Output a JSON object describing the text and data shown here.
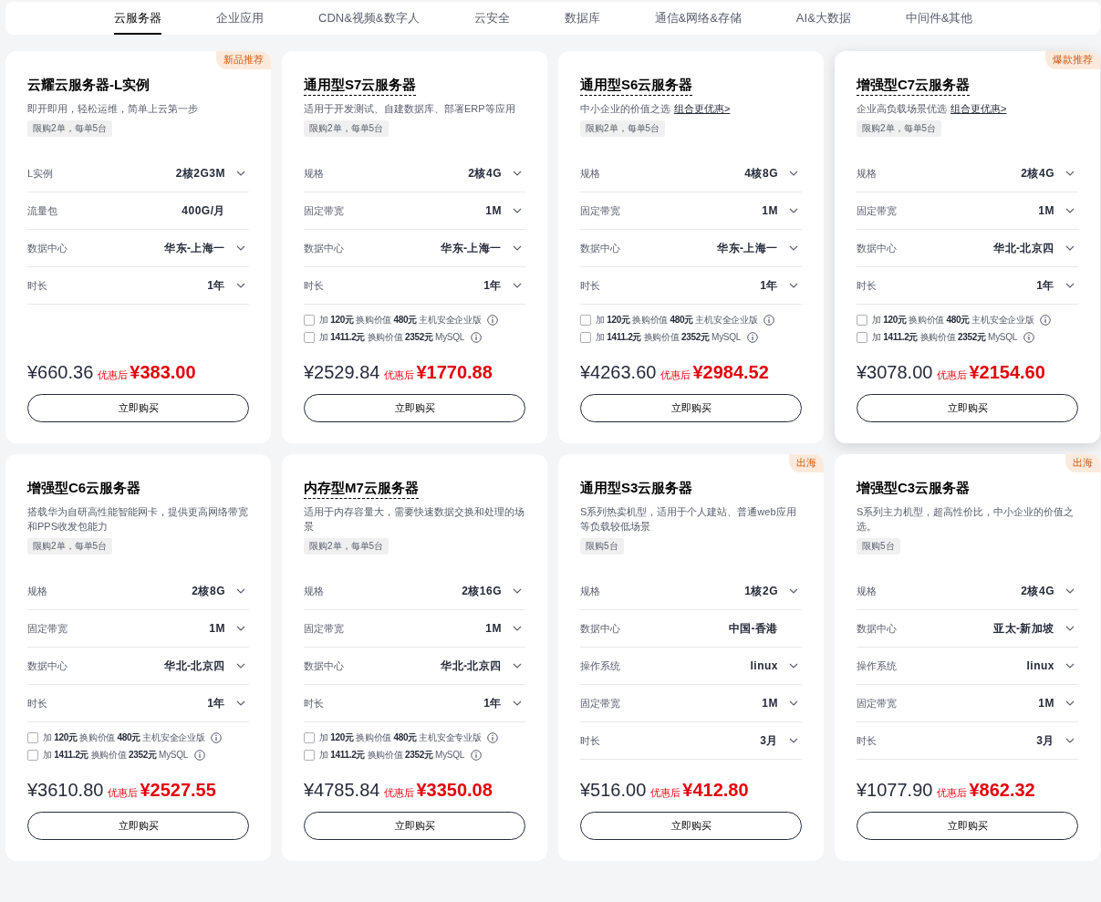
{
  "tabs": [
    {
      "label": "云服务器",
      "selected": true
    },
    {
      "label": "企业应用",
      "selected": false
    },
    {
      "label": "CDN&视频&数字人",
      "selected": false
    },
    {
      "label": "云安全",
      "selected": false
    },
    {
      "label": "数据库",
      "selected": false
    },
    {
      "label": "通信&网络&存储",
      "selected": false
    },
    {
      "label": "AI&大数据",
      "selected": false
    },
    {
      "label": "中间件&其他",
      "selected": false
    }
  ],
  "cards": [
    {
      "badge": "新品推荐",
      "title": "云耀云服务器-L实例",
      "underlined": false,
      "hovered": false,
      "description": "即开即用，轻松运维，简单上云第一步",
      "limit": "限购2单，每单5台",
      "specs": [
        {
          "label": "L实例",
          "value": "2核2G3M",
          "dropdown": true
        },
        {
          "label": "流量包",
          "value": "400G/月",
          "dropdown": false
        },
        {
          "label": "数据中心",
          "value": "华东-上海一",
          "dropdown": true
        },
        {
          "label": "时长",
          "value": "1年",
          "dropdown": true
        }
      ],
      "original_price": "¥660.36",
      "discount_label": "优惠后",
      "price": "¥383.00",
      "button": "立即购买"
    },
    {
      "title": "通用型S7云服务器",
      "underlined": true,
      "hovered": false,
      "description": "适用于开发测试、自建数据库、部署ERP等应用",
      "limit": "限购2单，每单5台",
      "specs": [
        {
          "label": "规格",
          "value": "2核4G",
          "dropdown": true
        },
        {
          "label": "固定带宽",
          "value": "1M",
          "dropdown": true
        },
        {
          "label": "数据中心",
          "value": "华东-上海一",
          "dropdown": true
        },
        {
          "label": "时长",
          "value": "1年",
          "dropdown": true
        }
      ],
      "addons": [
        {
          "text": "加 **120元** 换购价值 **480元** 主机安全企业版",
          "checked": false
        },
        {
          "text": "加 **1411.2元** 换购价值 **2352元** MySQL",
          "checked": false
        }
      ],
      "original_price": "¥2529.84",
      "discount_label": "优惠后",
      "price": "¥1770.88",
      "button": "立即购买"
    },
    {
      "title": "通用型S6云服务器",
      "underlined": true,
      "hovered": false,
      "description": "中小企业的价值之选",
      "link": "组合更优惠>",
      "limit": "限购2单，每单5台",
      "specs": [
        {
          "label": "规格",
          "value": "4核8G",
          "dropdown": true
        },
        {
          "label": "固定带宽",
          "value": "1M",
          "dropdown": true
        },
        {
          "label": "数据中心",
          "value": "华东-上海一",
          "dropdown": true
        },
        {
          "label": "时长",
          "value": "1年",
          "dropdown": true
        }
      ],
      "addons": [
        {
          "text": "加 **120元** 换购价值 **480元** 主机安全企业版",
          "checked": false
        },
        {
          "text": "加 **1411.2元** 换购价值 **2352元** MySQL",
          "checked": false
        }
      ],
      "original_price": "¥4263.60",
      "discount_label": "优惠后",
      "price": "¥2984.52",
      "button": "立即购买"
    },
    {
      "badge": "爆款推荐",
      "title": "增强型C7云服务器",
      "underlined": true,
      "hovered": true,
      "description": "企业高负载场景优选",
      "link": "组合更优惠>",
      "limit": "限购2单，每单5台",
      "specs": [
        {
          "label": "规格",
          "value": "2核4G",
          "dropdown": true
        },
        {
          "label": "固定带宽",
          "value": "1M",
          "dropdown": true
        },
        {
          "label": "数据中心",
          "value": "华北-北京四",
          "dropdown": true
        },
        {
          "label": "时长",
          "value": "1年",
          "dropdown": true
        }
      ],
      "addons": [
        {
          "text": "加 **120元** 换购价值 **480元** 主机安全企业版",
          "checked": false
        },
        {
          "text": "加 **1411.2元** 换购价值 **2352元** MySQL",
          "checked": false
        }
      ],
      "original_price": "¥3078.00",
      "discount_label": "优惠后",
      "price": "¥2154.60",
      "button": "立即购买"
    },
    {
      "title": "增强型C6云服务器",
      "underlined": false,
      "hovered": false,
      "description": "搭载华为自研高性能智能网卡，提供更高网络带宽和PPS收发包能力",
      "limit": "限购2单，每单5台",
      "specs": [
        {
          "label": "规格",
          "value": "2核8G",
          "dropdown": true
        },
        {
          "label": "固定带宽",
          "value": "1M",
          "dropdown": true
        },
        {
          "label": "数据中心",
          "value": "华北-北京四",
          "dropdown": true
        },
        {
          "label": "时长",
          "value": "1年",
          "dropdown": true
        }
      ],
      "addons": [
        {
          "text": "加 **120元** 换购价值 **480元** 主机安全企业版",
          "checked": false
        },
        {
          "text": "加 **1411.2元** 换购价值 **2352元** MySQL",
          "checked": false
        }
      ],
      "original_price": "¥3610.80",
      "discount_label": "优惠后",
      "price": "¥2527.55",
      "button": "立即购买"
    },
    {
      "title": "内存型M7云服务器",
      "underlined": true,
      "hovered": false,
      "description": "适用于内存容量大，需要快速数据交换和处理的场景",
      "limit": "限购2单，每单5台",
      "specs": [
        {
          "label": "规格",
          "value": "2核16G",
          "dropdown": true
        },
        {
          "label": "固定带宽",
          "value": "1M",
          "dropdown": true
        },
        {
          "label": "数据中心",
          "value": "华北-北京四",
          "dropdown": true
        },
        {
          "label": "时长",
          "value": "1年",
          "dropdown": true
        }
      ],
      "addons": [
        {
          "text": "加 **120元** 换购价值 **480元** 主机安全专业版",
          "checked": false
        },
        {
          "text": "加 **1411.2元** 换购价值 **2352元** MySQL",
          "checked": false
        }
      ],
      "original_price": "¥4785.84",
      "discount_label": "优惠后",
      "price": "¥3350.08",
      "button": "立即购买"
    },
    {
      "badge": "出海",
      "title": "通用型S3云服务器",
      "underlined": false,
      "hovered": false,
      "description": "S系列热卖机型，适用于个人建站、普通web应用等负载较低场景",
      "limit": "限购5台",
      "specs": [
        {
          "label": "规格",
          "value": "1核2G",
          "dropdown": true
        },
        {
          "label": "数据中心",
          "value": "中国-香港",
          "dropdown": false
        },
        {
          "label": "操作系统",
          "value": "linux",
          "dropdown": true
        },
        {
          "label": "固定带宽",
          "value": "1M",
          "dropdown": true
        },
        {
          "label": "时长",
          "value": "3月",
          "dropdown": true
        }
      ],
      "original_price": "¥516.00",
      "discount_label": "优惠后",
      "price": "¥412.80",
      "button": "立即购买"
    },
    {
      "badge": "出海",
      "title": "增强型C3云服务器",
      "underlined": false,
      "hovered": false,
      "description": "S系列主力机型，超高性价比，中小企业的价值之选。",
      "limit": "限购5台",
      "specs": [
        {
          "label": "规格",
          "value": "2核4G",
          "dropdown": true
        },
        {
          "label": "数据中心",
          "value": "亚太-新加坡",
          "dropdown": true
        },
        {
          "label": "操作系统",
          "value": "linux",
          "dropdown": true
        },
        {
          "label": "固定带宽",
          "value": "1M",
          "dropdown": true
        },
        {
          "label": "时长",
          "value": "3月",
          "dropdown": true
        }
      ],
      "original_price": "¥1077.90",
      "discount_label": "优惠后",
      "price": "¥862.32",
      "button": "立即购买"
    }
  ]
}
